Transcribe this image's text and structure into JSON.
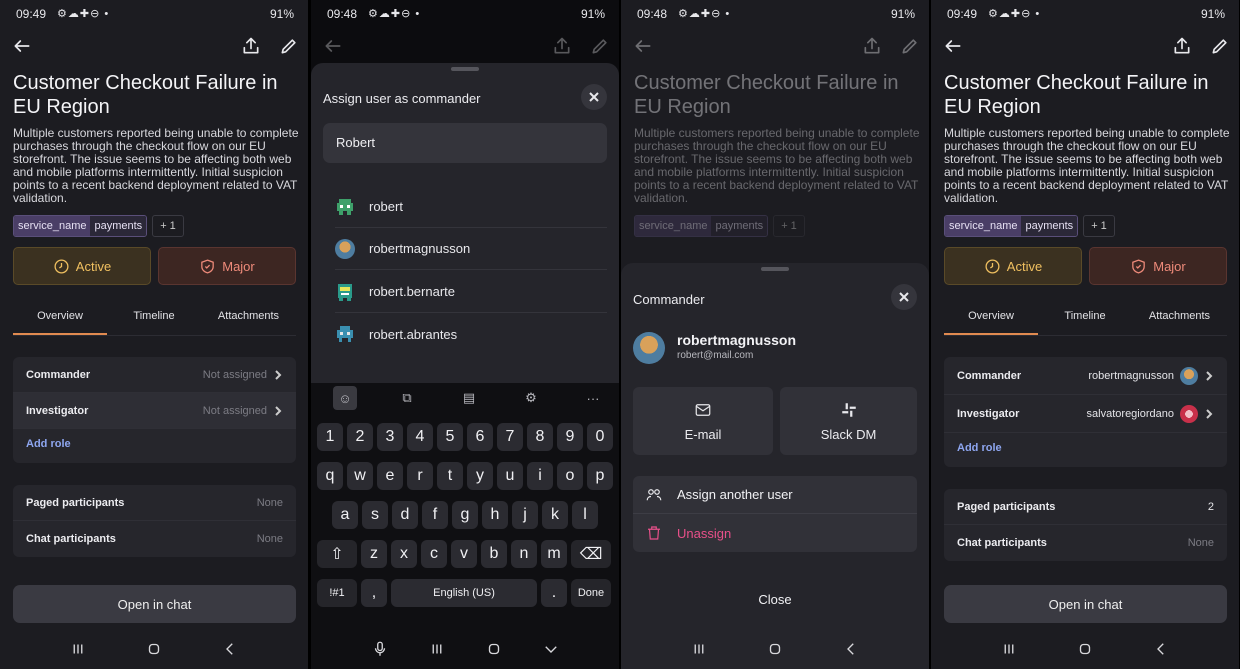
{
  "status": [
    {
      "time": "09:49",
      "icons": "⚙☁✚⊖ •",
      "battery": "91%"
    },
    {
      "time": "09:48",
      "icons": "⚙☁✚⊖ •",
      "battery": "91%"
    },
    {
      "time": "09:48",
      "icons": "⚙☁✚⊖ •",
      "battery": "91%"
    },
    {
      "time": "09:49",
      "icons": "⚙☁✚⊖ •",
      "battery": "91%"
    }
  ],
  "incident": {
    "title": "Customer Checkout Failure in EU Region",
    "description": "Multiple customers reported being unable to complete purchases through the checkout flow on our EU storefront. The issue seems to be affecting both web and mobile platforms intermittently. Initial suspicion points to a recent backend deployment related to VAT validation.",
    "tag_key": "service_name",
    "tag_value": "payments",
    "tag_more": "+ 1",
    "status_label": "Active",
    "severity_label": "Major"
  },
  "tabs": [
    "Overview",
    "Timeline",
    "Attachments"
  ],
  "roles_before": {
    "commander_label": "Commander",
    "commander_value": "Not assigned",
    "investigator_label": "Investigator",
    "investigator_value": "Not assigned",
    "add_role": "Add role"
  },
  "participants_before": {
    "paged_label": "Paged participants",
    "paged_value": "None",
    "chat_label": "Chat participants",
    "chat_value": "None"
  },
  "roles_after": {
    "commander_label": "Commander",
    "commander_value": "robertmagnusson",
    "investigator_label": "Investigator",
    "investigator_value": "salvatoregiordano",
    "add_role": "Add role"
  },
  "participants_after": {
    "paged_label": "Paged participants",
    "paged_value": "2",
    "chat_label": "Chat participants",
    "chat_value": "None"
  },
  "open_chat": "Open in chat",
  "assign_sheet": {
    "title": "Assign user as commander",
    "search_value": "Robert",
    "users": [
      "robert",
      "robertmagnusson",
      "robert.bernarte",
      "robert.abrantes"
    ]
  },
  "keyboard": {
    "row1": [
      "1",
      "2",
      "3",
      "4",
      "5",
      "6",
      "7",
      "8",
      "9",
      "0"
    ],
    "row2": [
      "q",
      "w",
      "e",
      "r",
      "t",
      "y",
      "u",
      "i",
      "o",
      "p"
    ],
    "row3": [
      "a",
      "s",
      "d",
      "f",
      "g",
      "h",
      "j",
      "k",
      "l"
    ],
    "row4": [
      "z",
      "x",
      "c",
      "v",
      "b",
      "n",
      "m"
    ],
    "symbols": "!#1",
    "comma": ",",
    "space": "English (US)",
    "period": ".",
    "done": "Done"
  },
  "commander_sheet": {
    "title": "Commander",
    "name": "robertmagnusson",
    "email": "robert@mail.com",
    "email_btn": "E-mail",
    "slack_btn": "Slack DM",
    "assign_another": "Assign another user",
    "unassign": "Unassign",
    "close": "Close"
  },
  "colors": {
    "active": "#f0c060",
    "major": "#ee8a7a",
    "link": "#8ea6f0",
    "unassign": "#e8508a",
    "tab_underline": "#e08a50"
  }
}
